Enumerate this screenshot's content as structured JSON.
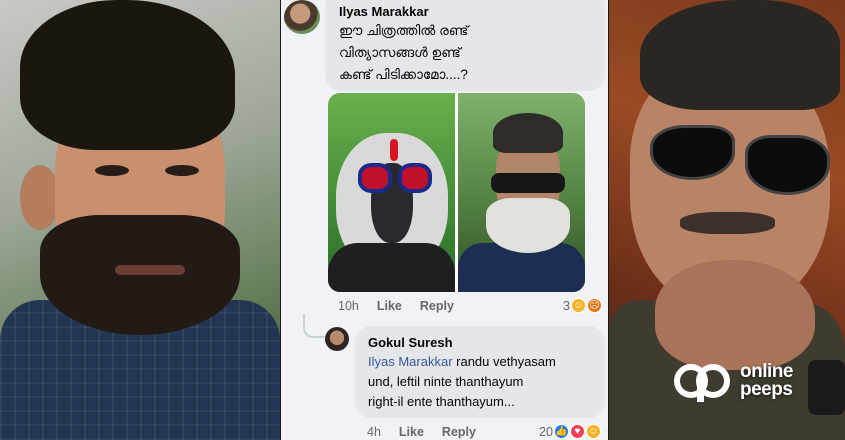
{
  "comment": {
    "author": "Ilyas Marakkar",
    "lines": [
      "ഈ ചിത്രത്തിൽ രണ്ട്",
      "വിത്യാസങ്ങൾ ഉണ്ട്",
      "കണ്ട് പിടിക്കാമോ....?"
    ],
    "time": "10h",
    "like_label": "Like",
    "reply_label": "Reply",
    "reaction_count": "3",
    "reaction_icons": [
      "haha-icon",
      "angry-icon"
    ]
  },
  "reply": {
    "author": "Gokul Suresh",
    "mention": "Ilyas Marakkar",
    "line1_rest": " randu vethyasam",
    "line2": "und, leftil ninte thanthayum",
    "line3": "right-il ente thanthayum...",
    "time": "4h",
    "like_label": "Like",
    "reply_label": "Reply",
    "reaction_count": "20",
    "reaction_icons": [
      "like-icon",
      "love-icon",
      "haha-icon"
    ]
  },
  "watermark": {
    "line1": "online",
    "line2": "peeps"
  },
  "colors": {
    "comment_bubble": "#e4e6ea",
    "mention": "#385898",
    "meta_text": "#65676b"
  }
}
